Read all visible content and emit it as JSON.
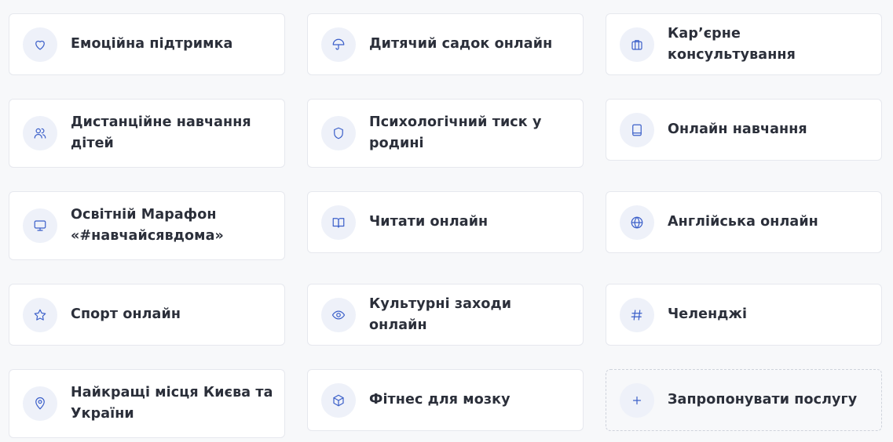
{
  "services": [
    {
      "label": "Емоційна підтримка",
      "icon": "heart-icon"
    },
    {
      "label": "Дитячий садок онлайн",
      "icon": "umbrella-icon"
    },
    {
      "label": "Кар’єрне консультування",
      "icon": "briefcase-icon"
    },
    {
      "label": "Дистанційне навчання дітей",
      "icon": "users-icon"
    },
    {
      "label": "Психологічний тиск у родині",
      "icon": "shield-icon"
    },
    {
      "label": "Онлайн навчання",
      "icon": "book-icon"
    },
    {
      "label": "Освітній Марафон «#навчайсявдома»",
      "icon": "monitor-icon"
    },
    {
      "label": "Читати онлайн",
      "icon": "open-book-icon"
    },
    {
      "label": "Англійська онлайн",
      "icon": "globe-icon"
    },
    {
      "label": "Спорт онлайн",
      "icon": "star-icon"
    },
    {
      "label": "Культурні заходи онлайн",
      "icon": "eye-icon"
    },
    {
      "label": "Челенджі",
      "icon": "hash-icon"
    },
    {
      "label": "Найкращі місця Києва та України",
      "icon": "map-pin-icon"
    },
    {
      "label": "Фітнес для мозку",
      "icon": "cube-icon"
    }
  ],
  "suggest": {
    "label": "Запропонувати послугу",
    "icon": "plus-icon"
  },
  "colors": {
    "accent": "#3b5fc9",
    "icon_bg": "#eef1f9",
    "text": "#2b2f3a",
    "card_border": "#e6e8ee"
  }
}
